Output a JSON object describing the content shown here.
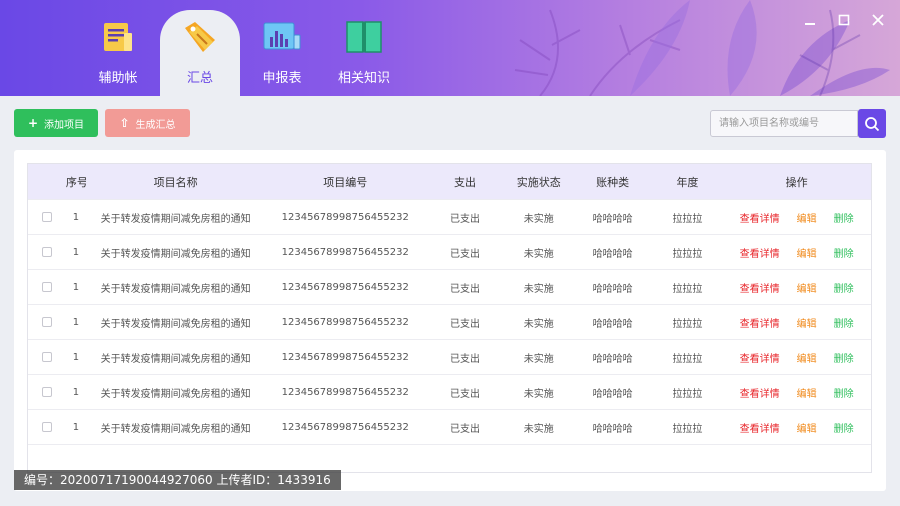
{
  "window": {
    "controls": [
      "minimize-icon",
      "maximize-icon",
      "close-icon"
    ]
  },
  "nav": {
    "tabs": [
      {
        "label": "辅助帐",
        "icon": "ledger-book-icon",
        "active": false
      },
      {
        "label": "汇总",
        "icon": "price-tag-icon",
        "active": true
      },
      {
        "label": "申报表",
        "icon": "bar-chart-icon",
        "active": false
      },
      {
        "label": "相关知识",
        "icon": "open-book-icon",
        "active": false
      }
    ]
  },
  "toolbar": {
    "add_label": "添加项目",
    "generate_label": "生成汇总",
    "search_placeholder": "请输入项目名称或编号"
  },
  "table": {
    "headers": [
      "序号",
      "项目名称",
      "项目编号",
      "支出",
      "实施状态",
      "账种类",
      "年度",
      "操作"
    ],
    "rows": [
      {
        "no": "1",
        "name": "关于转发疫情期间减免房租的通知",
        "code": "12345678998756455232",
        "pay": "已支出",
        "status": "未实施",
        "account": "哈哈哈哈",
        "year": "拉拉拉"
      },
      {
        "no": "1",
        "name": "关于转发疫情期间减免房租的通知",
        "code": "12345678998756455232",
        "pay": "已支出",
        "status": "未实施",
        "account": "哈哈哈哈",
        "year": "拉拉拉"
      },
      {
        "no": "1",
        "name": "关于转发疫情期间减免房租的通知",
        "code": "12345678998756455232",
        "pay": "已支出",
        "status": "未实施",
        "account": "哈哈哈哈",
        "year": "拉拉拉"
      },
      {
        "no": "1",
        "name": "关于转发疫情期间减免房租的通知",
        "code": "12345678998756455232",
        "pay": "已支出",
        "status": "未实施",
        "account": "哈哈哈哈",
        "year": "拉拉拉"
      },
      {
        "no": "1",
        "name": "关于转发疫情期间减免房租的通知",
        "code": "12345678998756455232",
        "pay": "已支出",
        "status": "未实施",
        "account": "哈哈哈哈",
        "year": "拉拉拉"
      },
      {
        "no": "1",
        "name": "关于转发疫情期间减免房租的通知",
        "code": "12345678998756455232",
        "pay": "已支出",
        "status": "未实施",
        "account": "哈哈哈哈",
        "year": "拉拉拉"
      },
      {
        "no": "1",
        "name": "关于转发疫情期间减免房租的通知",
        "code": "12345678998756455232",
        "pay": "已支出",
        "status": "未实施",
        "account": "哈哈哈哈",
        "year": "拉拉拉"
      }
    ],
    "ops": {
      "view": "查看详情",
      "edit": "编辑",
      "delete": "删除"
    }
  },
  "footer": {
    "text": "编号：20200717190044927060 上传者ID：1433916"
  },
  "colors": {
    "accent": "#6a48e6",
    "add_button": "#2fbf5c",
    "generate_button": "#f29b96",
    "view_link": "#e8262b",
    "edit_link": "#f08a1c",
    "delete_link": "#2fbf5c",
    "header_row": "#ece9fb"
  }
}
